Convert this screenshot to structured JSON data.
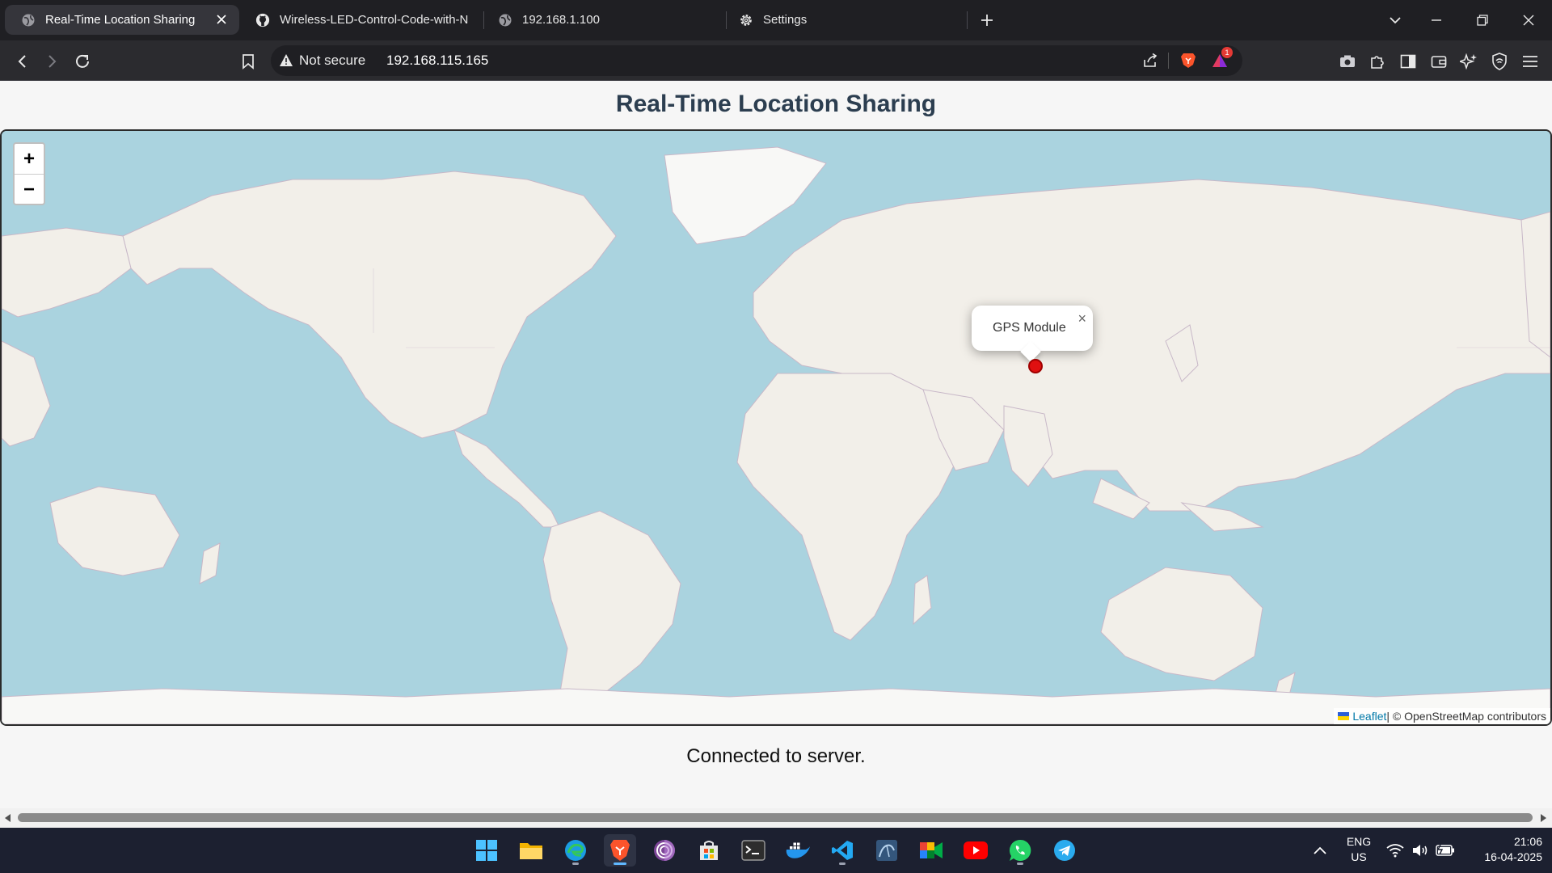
{
  "browser": {
    "tabs": [
      {
        "label": "Real-Time Location Sharing",
        "active": true
      },
      {
        "label": "Wireless-LED-Control-Code-with-N",
        "active": false
      },
      {
        "label": "192.168.1.100",
        "active": false
      },
      {
        "label": "Settings",
        "active": false
      }
    ],
    "security_label": "Not secure",
    "url": "192.168.115.165",
    "brave_rewards_badge": "1"
  },
  "page": {
    "title": "Real-Time Location Sharing",
    "map": {
      "zoom_in": "+",
      "zoom_out": "−",
      "popup_text": "GPS Module",
      "popup_close": "×",
      "attribution_link": "Leaflet",
      "attribution_rest": " | © OpenStreetMap contributors",
      "marker_color": "#e01010"
    },
    "status": "Connected to server."
  },
  "taskbar": {
    "apps": [
      "windows-start",
      "file-explorer",
      "edge",
      "brave",
      "tor",
      "microsoft-store",
      "terminal",
      "docker",
      "vscode",
      "mysql-workbench",
      "google-meet",
      "youtube",
      "whatsapp",
      "telegram"
    ],
    "language": "ENG",
    "region": "US",
    "time": "21:06",
    "date": "16-04-2025"
  },
  "colors": {
    "water": "#aad3df",
    "land": "#f2efe9",
    "ice": "#f8f8f6",
    "title": "#2c3e50"
  }
}
